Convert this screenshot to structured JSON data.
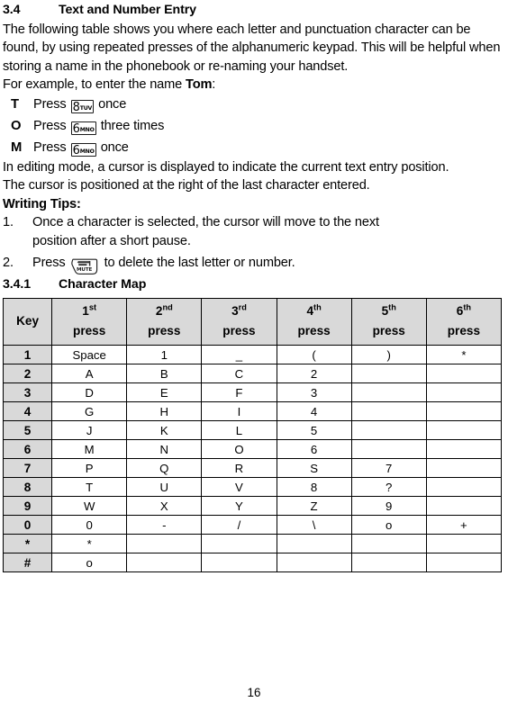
{
  "section": {
    "number": "3.4",
    "title": "Text and Number Entry"
  },
  "intro": {
    "paragraph": "The following table shows you where each letter and punctuation character can be found, by using repeated presses of the alphanumeric keypad. This will be helpful when storing a name in the phonebook or re-naming your handset.",
    "example_prefix": "For example, to enter the name ",
    "example_name": "Tom",
    "example_suffix": ":"
  },
  "press_examples": [
    {
      "letter": "T",
      "verb": "Press",
      "key_digit": "8",
      "key_letters": "TUV",
      "key_icon": "keypad-8-tuv-icon",
      "tail": "once"
    },
    {
      "letter": "O",
      "verb": "Press",
      "key_digit": "6",
      "key_letters": "MNO",
      "key_icon": "keypad-6-mno-icon",
      "tail": "three times"
    },
    {
      "letter": "M",
      "verb": "Press",
      "key_digit": "6",
      "key_letters": "MNO",
      "key_icon": "keypad-6-mno-icon",
      "tail": "once"
    }
  ],
  "editing_notes": {
    "line1": "In editing mode, a cursor is displayed to indicate the current text entry position.",
    "line2": "The cursor is positioned at the right of the last character entered."
  },
  "writing_tips": {
    "heading": "Writing Tips:",
    "items": [
      {
        "marker": "1.",
        "line1": "Once a character is selected, the cursor will move to the next",
        "line2": "position after a short pause."
      },
      {
        "marker": "2.",
        "verb": "Press",
        "key_label": "MUTE",
        "key_icon": "mute-key-icon",
        "tail": "to delete the last letter or number."
      }
    ]
  },
  "subsection": {
    "number": "3.4.1",
    "title": "Character Map"
  },
  "character_map": {
    "headers": [
      {
        "label": "Key",
        "ordinal": "",
        "sup": "",
        "press_word": ""
      },
      {
        "label": "1st press",
        "ordinal": "1",
        "sup": "st",
        "press_word": "press"
      },
      {
        "label": "2nd press",
        "ordinal": "2",
        "sup": "nd",
        "press_word": "press"
      },
      {
        "label": "3rd press",
        "ordinal": "3",
        "sup": "rd",
        "press_word": "press"
      },
      {
        "label": "4th press",
        "ordinal": "4",
        "sup": "th",
        "press_word": "press"
      },
      {
        "label": "5th press",
        "ordinal": "5",
        "sup": "th",
        "press_word": "press"
      },
      {
        "label": "6th press",
        "ordinal": "6",
        "sup": "th",
        "press_word": "press"
      }
    ],
    "rows": [
      {
        "key": "1",
        "presses": [
          "Space",
          "1",
          "_",
          "(",
          ")",
          "*"
        ]
      },
      {
        "key": "2",
        "presses": [
          "A",
          "B",
          "C",
          "2",
          "",
          ""
        ]
      },
      {
        "key": "3",
        "presses": [
          "D",
          "E",
          "F",
          "3",
          "",
          ""
        ]
      },
      {
        "key": "4",
        "presses": [
          "G",
          "H",
          "I",
          "4",
          "",
          ""
        ]
      },
      {
        "key": "5",
        "presses": [
          "J",
          "K",
          "L",
          "5",
          "",
          ""
        ]
      },
      {
        "key": "6",
        "presses": [
          "M",
          "N",
          "O",
          "6",
          "",
          ""
        ]
      },
      {
        "key": "7",
        "presses": [
          "P",
          "Q",
          "R",
          "S",
          "7",
          ""
        ]
      },
      {
        "key": "8",
        "presses": [
          "T",
          "U",
          "V",
          "8",
          "?",
          ""
        ]
      },
      {
        "key": "9",
        "presses": [
          "W",
          "X",
          "Y",
          "Z",
          "9",
          ""
        ]
      },
      {
        "key": "0",
        "presses": [
          "0",
          "-",
          "/",
          "\\",
          "o",
          "+"
        ]
      },
      {
        "key": "*",
        "presses": [
          "*",
          "",
          "",
          "",
          "",
          ""
        ]
      },
      {
        "key": "#",
        "presses": [
          "o",
          "",
          "",
          "",
          "",
          ""
        ]
      }
    ]
  },
  "footer": {
    "page_number": "16"
  },
  "colors": {
    "header_fill": "#d9d9d9",
    "border": "#000000",
    "text": "#000000"
  }
}
